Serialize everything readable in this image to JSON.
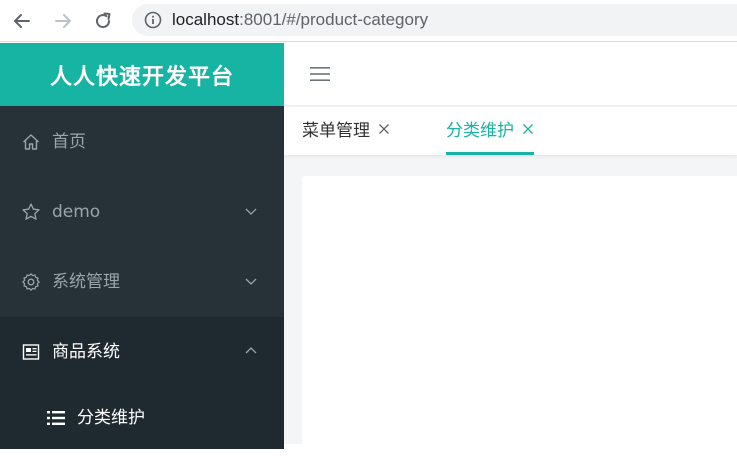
{
  "browser": {
    "url_host": "localhost",
    "url_rest": ":8001/#/product-category"
  },
  "brand": {
    "title": "人人快速开发平台"
  },
  "sidebar": {
    "items": [
      {
        "label": "首页",
        "icon": "home-icon",
        "has_arrow": false
      },
      {
        "label": "demo",
        "icon": "star-icon",
        "has_arrow": true,
        "expanded": false
      },
      {
        "label": "系统管理",
        "icon": "gear-icon",
        "has_arrow": true,
        "expanded": false
      },
      {
        "label": "商品系统",
        "icon": "product-icon",
        "has_arrow": true,
        "expanded": true
      }
    ],
    "submenu": [
      {
        "label": "分类维护",
        "icon": "list-icon"
      }
    ]
  },
  "tabs": [
    {
      "label": "菜单管理",
      "active": false
    },
    {
      "label": "分类维护",
      "active": true
    }
  ],
  "colors": {
    "accent": "#17b3a3",
    "sidebar_bg": "#263238",
    "sidebar_active_bg": "#1f2a30",
    "sidebar_text": "#9aa4ab"
  }
}
